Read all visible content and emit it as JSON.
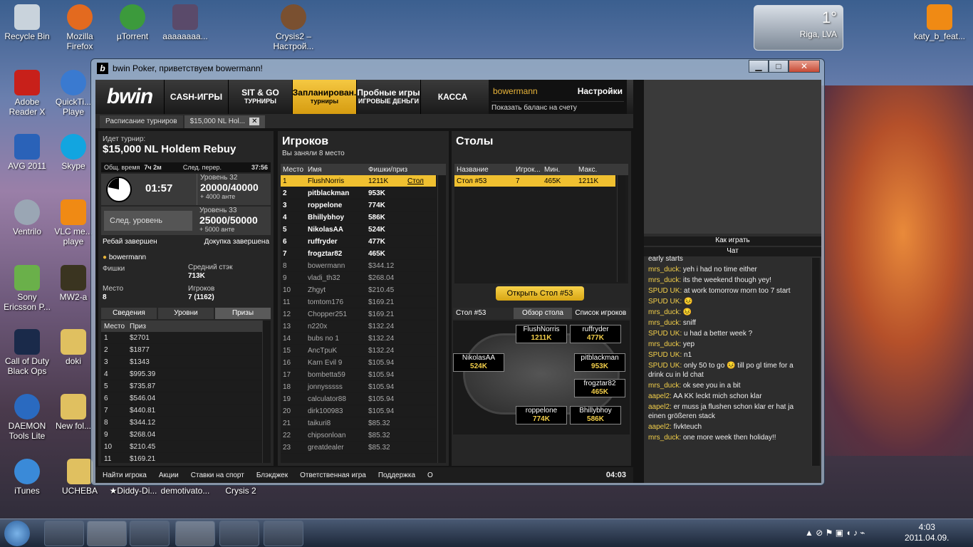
{
  "desktop": {
    "icons": [
      "Recycle Bin",
      "Mozilla Firefox",
      "µTorrent",
      "аааааааа...",
      "Crysis2 – Настрой...",
      "Adobe Reader X",
      "QuickTi... Playe",
      "AVG 2011",
      "Skype",
      "Ventrilo",
      "VLC me... playe",
      "Sony Ericsson P...",
      "MW2-a",
      "Call of Duty Black Ops",
      "doki",
      "DAEMON Tools Lite",
      "New fol...",
      "iTunes",
      "UCHEBA",
      "★Diddy-Di...",
      "demotivato...",
      "Crysis 2",
      "katy_b_feat..."
    ],
    "weather": {
      "temp": "1°",
      "city": "Riga, LVA"
    }
  },
  "window": {
    "title": "bwin Poker, приветствуем bowermann!",
    "min": "▁",
    "max": "□",
    "close": "✕"
  },
  "nav": {
    "logo": "bwin",
    "cash": "CASH-ИГРЫ",
    "sitgo": "SIT & GO",
    "sitgo_sub": "ТУРНИРЫ",
    "sched": "Запланирован.",
    "sched_sub": "турниры",
    "trial": "Пробные игры",
    "trial_sub": "ИГРОВЫЕ ДЕНЬГИ",
    "cashier": "КАССА",
    "user": "bowermann",
    "settings": "Настройки",
    "balance": "Показать баланс на счету"
  },
  "tabs": {
    "schedule": "Расписание турниров",
    "current": "$15,000 NL Hol...",
    "close": "✕"
  },
  "tourney": {
    "running": "Идет турнир:",
    "name": "$15,000 NL Holdem Rebuy",
    "total_time_l": "Общ. время",
    "total_time": "7ч 2м",
    "next_break_l": "След. перер.",
    "next_break": "37:56",
    "timer": "01:57",
    "lvl_l": "Уровень 32",
    "lvl": "20000/40000",
    "ante": "+ 4000 анте",
    "next_lbl": "След. уровень",
    "nlvl_l": "Уровень 33",
    "nlvl": "25000/50000",
    "nante": "+ 5000 анте",
    "rebuy": "Ребай завершен",
    "addon": "Докупка завершена",
    "player": "bowermann",
    "chips_l": "Фишки",
    "avg_l": "Средний стэк",
    "avg": "713K",
    "place_l": "Место",
    "place": "8",
    "players_l": "Игроков",
    "players": "7 (1162)",
    "subtabs": [
      "Сведения",
      "Уровни",
      "Призы"
    ],
    "prize_h": [
      "Место",
      "Приз"
    ],
    "prizes": [
      [
        "1",
        "$2701"
      ],
      [
        "2",
        "$1877"
      ],
      [
        "3",
        "$1343"
      ],
      [
        "4",
        "$995.39"
      ],
      [
        "5",
        "$735.87"
      ],
      [
        "6",
        "$546.04"
      ],
      [
        "7",
        "$440.81"
      ],
      [
        "8",
        "$344.12"
      ],
      [
        "9",
        "$268.04"
      ],
      [
        "10",
        "$210.45"
      ],
      [
        "11",
        "$169.21"
      ]
    ]
  },
  "players": {
    "title": "Игроков",
    "place": "Вы заняли  8 место",
    "h": [
      "Место",
      "Имя",
      "Фишки/приз"
    ],
    "table_link": "Стол",
    "rows": [
      [
        "1",
        "FlushNorris",
        "1211K"
      ],
      [
        "2",
        "pitblackman",
        "953K"
      ],
      [
        "3",
        "roppelone",
        "774K"
      ],
      [
        "4",
        "Bhillybhoy",
        "586K"
      ],
      [
        "5",
        "NikolasAA",
        "524K"
      ],
      [
        "6",
        "ruffryder",
        "477K"
      ],
      [
        "7",
        "frogztar82",
        "465K"
      ],
      [
        "8",
        "bowermann",
        "$344.12"
      ],
      [
        "9",
        "vladi_th32",
        "$268.04"
      ],
      [
        "10",
        "Zhgyt",
        "$210.45"
      ],
      [
        "11",
        "tomtom176",
        "$169.21"
      ],
      [
        "12",
        "Chopper251",
        "$169.21"
      ],
      [
        "13",
        "n220x",
        "$132.24"
      ],
      [
        "14",
        "bubs no 1",
        "$132.24"
      ],
      [
        "15",
        "AncTpuK",
        "$132.24"
      ],
      [
        "16",
        "Karn Evil 9",
        "$105.94"
      ],
      [
        "17",
        "bombetta59",
        "$105.94"
      ],
      [
        "18",
        "jonnysssss",
        "$105.94"
      ],
      [
        "19",
        "calculator88",
        "$105.94"
      ],
      [
        "20",
        "dirk100983",
        "$105.94"
      ],
      [
        "21",
        "taikuri8",
        "$85.32"
      ],
      [
        "22",
        "chipsonloan",
        "$85.32"
      ],
      [
        "23",
        "greatdealer",
        "$85.32"
      ]
    ]
  },
  "tables": {
    "title": "Столы",
    "h": [
      "Название",
      "Игрок...",
      "Мин.",
      "Макс."
    ],
    "row": [
      "Стол #53",
      "7",
      "465K",
      "1211K"
    ],
    "open": "Открыть Стол #53",
    "tabs": [
      "Стол #53",
      "Обзор стола",
      "Список игроков"
    ],
    "seats": [
      [
        "FlushNorris",
        "1211K"
      ],
      [
        "ruffryder",
        "477K"
      ],
      [
        "NikolasAA",
        "524K"
      ],
      [
        "pitblackman",
        "953K"
      ],
      [
        "frogztar82",
        "465K"
      ],
      [
        "roppelone",
        "774K"
      ],
      [
        "Bhillybhoy",
        "586K"
      ]
    ]
  },
  "bottom": {
    "links": [
      "Найти игрока",
      "Акции",
      "Ставки на спорт",
      "Блэкджек",
      "Ответственная игра",
      "Поддержка",
      "О"
    ],
    "time": "04:03"
  },
  "chat": {
    "howto": "Как играть",
    "chat": "Чат",
    "msgs": [
      [
        "",
        "early starts"
      ],
      [
        "mrs_duck:",
        "yeh i had no time either"
      ],
      [
        "mrs_duck:",
        "its the weekend though yey!"
      ],
      [
        "SPUD UK:",
        "at work tomorrow morn too 7 start"
      ],
      [
        "SPUD UK:",
        "😣"
      ],
      [
        "mrs_duck:",
        "😣"
      ],
      [
        "mrs_duck:",
        "sniff"
      ],
      [
        "SPUD UK:",
        "u had a better week ?"
      ],
      [
        "mrs_duck:",
        "yep"
      ],
      [
        "SPUD UK:",
        "n1"
      ],
      [
        "SPUD UK:",
        "only 50 to go  😣  till po gl time for a drink cu in ld chat"
      ],
      [
        "mrs_duck:",
        "ok see you in a bit"
      ],
      [
        "aapel2:",
        "AA KK leckt mich schon klar"
      ],
      [
        "aapel2:",
        "er muss ja flushen schon klar er hat ja einen größeren stack"
      ],
      [
        "aapel2:",
        "fivkteuch"
      ],
      [
        "mrs_duck:",
        "one more week then holiday!!"
      ]
    ]
  },
  "taskbar": {
    "time": "4:03",
    "date": "2011.04.09."
  }
}
